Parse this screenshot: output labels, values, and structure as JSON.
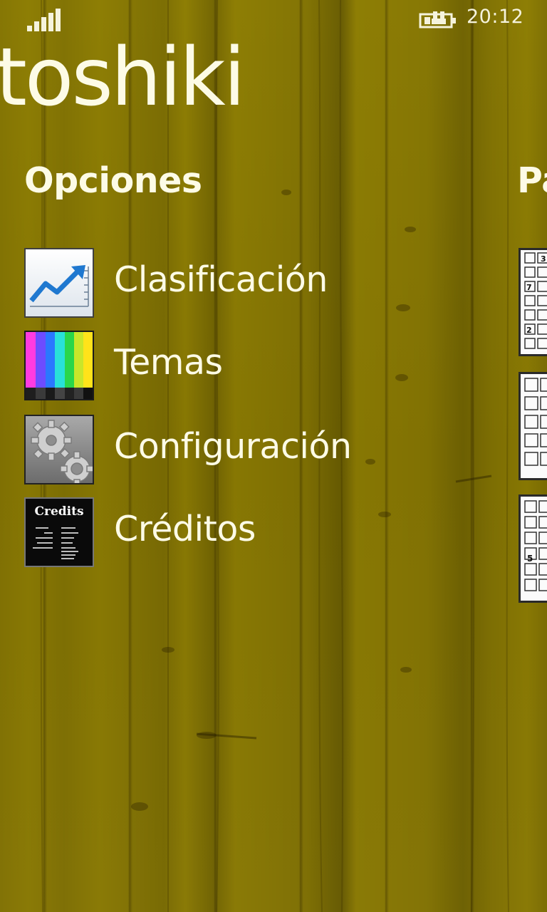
{
  "status_bar": {
    "time": "20:12",
    "signal_icon": "signal-bars-icon",
    "battery_icon": "battery-charging-icon"
  },
  "app": {
    "title": "toshiki"
  },
  "options_section": {
    "header": "Opciones",
    "items": [
      {
        "label": "Clasificación",
        "icon": "ranking-chart-icon"
      },
      {
        "label": "Temas",
        "icon": "color-bars-icon"
      },
      {
        "label": "Configuración",
        "icon": "gears-icon"
      },
      {
        "label": "Créditos",
        "icon": "credits-icon",
        "icon_text": "Credits"
      }
    ]
  },
  "next_section": {
    "header": "Pa",
    "puzzles": [
      {
        "clues": [
          "3",
          "7",
          "2"
        ]
      },
      {
        "clues": []
      },
      {
        "clues": [
          "5"
        ]
      }
    ]
  },
  "colors": {
    "background": "#8a7a06",
    "text": "#fdfbe6"
  }
}
